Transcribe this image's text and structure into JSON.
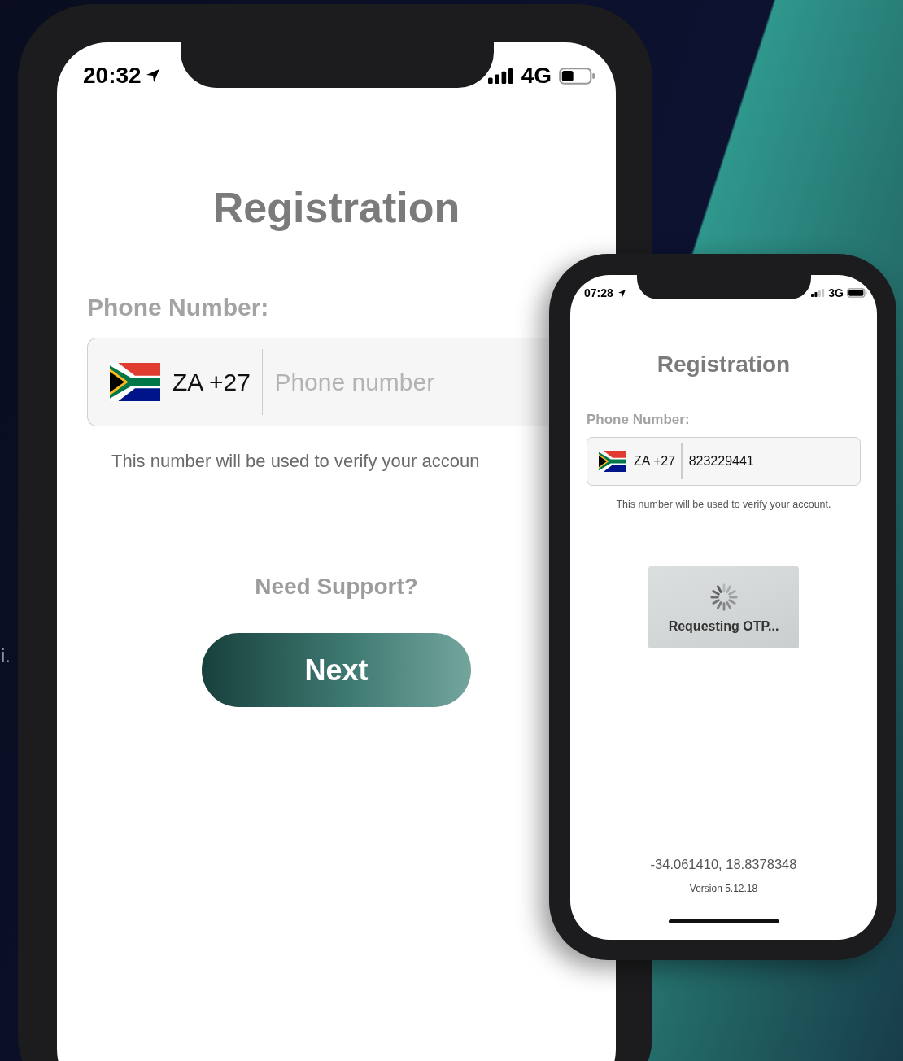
{
  "background_text": "i.",
  "main_screen": {
    "status_bar": {
      "time": "20:32",
      "network": "4G"
    },
    "title": "Registration",
    "phone_label": "Phone Number:",
    "phone_field": {
      "country_code": "ZA +27",
      "placeholder": "Phone number"
    },
    "helper_text": "This number will be used to verify your accoun",
    "support_link": "Need Support?",
    "next_button": "Next"
  },
  "overlay_screen": {
    "status_bar": {
      "time": "07:28",
      "network": "3G"
    },
    "title": "Registration",
    "phone_label": "Phone Number:",
    "phone_field": {
      "country_code": "ZA +27",
      "value": "823229441"
    },
    "helper_text": "This number will be used to verify your account.",
    "loading": {
      "label": "Requesting OTP..."
    },
    "coordinates": "-34.061410, 18.8378348",
    "version": "Version 5.12.18"
  }
}
